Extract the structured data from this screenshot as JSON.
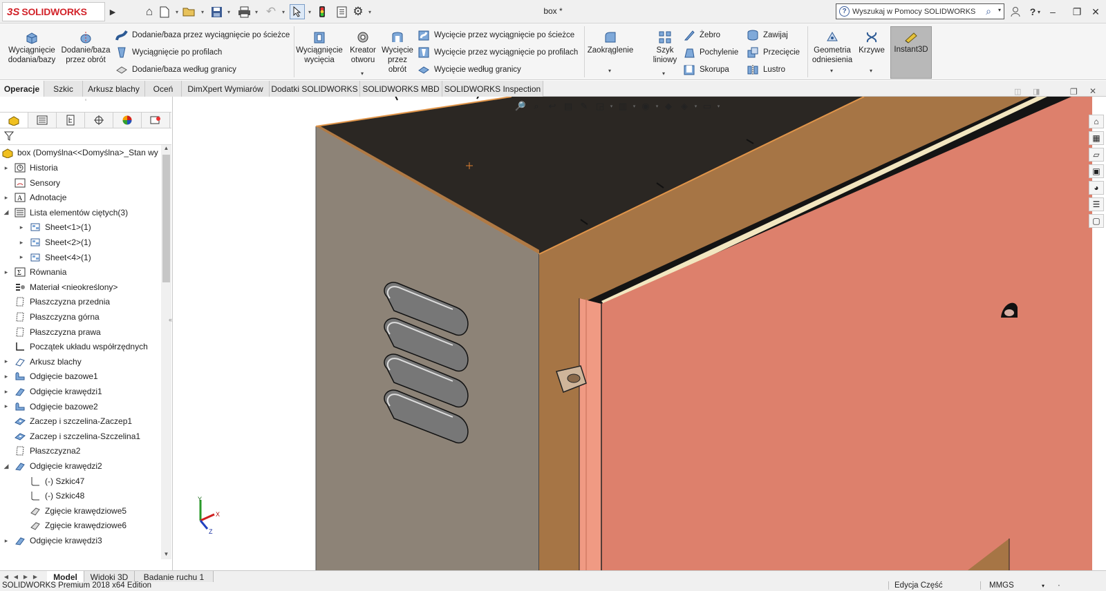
{
  "app": {
    "logo_prefix": "3S",
    "logo_text": "SOLIDWORKS",
    "document_title": "box *",
    "help_search_placeholder": "Wyszukaj w Pomocy SOLIDWORKS"
  },
  "ribbon": {
    "extrude_boss": "Wyciągnięcie dodania/bazy",
    "revolve_boss": "Dodanie/baza przez obrót",
    "swept_boss": "Dodanie/baza przez wyciągnięcie po ścieżce",
    "lofted_boss": "Wyciągnięcie po profilach",
    "boundary_boss": "Dodanie/baza według granicy",
    "extruded_cut": "Wyciągnięcie wycięcia",
    "hole_wizard": "Kreator otworu",
    "revolved_cut": "Wycięcie przez obrót",
    "swept_cut": "Wycięcie przez wyciągnięcie po ścieżce",
    "lofted_cut": "Wycięcie przez wyciągnięcie po profilach",
    "boundary_cut": "Wycięcie według granicy",
    "fillet": "Zaokrąglenie",
    "linear_pattern": "Szyk liniowy",
    "rib": "Żebro",
    "draft": "Pochylenie",
    "shell": "Skorupa",
    "wrap": "Zawijaj",
    "intersect": "Przecięcie",
    "mirror": "Lustro",
    "ref_geometry": "Geometria odniesienia",
    "curves": "Krzywe",
    "instant3d": "Instant3D"
  },
  "command_tabs": [
    "Operacje",
    "Szkic",
    "Arkusz blachy",
    "Oceń",
    "DimXpert Wymiarów",
    "Dodatki SOLIDWORKS",
    "SOLIDWORKS MBD",
    "SOLIDWORKS Inspection"
  ],
  "tree": {
    "root": "box  (Domyślna<<Domyślna>_Stan wy",
    "items": [
      {
        "label": "Historia",
        "icon": "history-icon",
        "expander": true,
        "indent": 0
      },
      {
        "label": "Sensory",
        "icon": "sensor-icon",
        "expander": false,
        "indent": 0
      },
      {
        "label": "Adnotacje",
        "icon": "annotation-icon",
        "expander": true,
        "indent": 0
      },
      {
        "label": "Lista elementów ciętych(3)",
        "icon": "cut-list-icon",
        "expander": "open",
        "indent": 0
      },
      {
        "label": "Sheet<1>(1)",
        "icon": "sheet-body-icon",
        "expander": true,
        "indent": 1
      },
      {
        "label": "Sheet<2>(1)",
        "icon": "sheet-body-icon",
        "expander": true,
        "indent": 1
      },
      {
        "label": "Sheet<4>(1)",
        "icon": "sheet-body-icon",
        "expander": true,
        "indent": 1
      },
      {
        "label": "Równania",
        "icon": "equations-icon",
        "expander": true,
        "indent": 0
      },
      {
        "label": "Materiał <nieokreślony>",
        "icon": "material-icon",
        "expander": false,
        "indent": 0
      },
      {
        "label": "Płaszczyzna przednia",
        "icon": "plane-icon",
        "expander": false,
        "indent": 0
      },
      {
        "label": "Płaszczyzna górna",
        "icon": "plane-icon",
        "expander": false,
        "indent": 0
      },
      {
        "label": "Płaszczyzna prawa",
        "icon": "plane-icon",
        "expander": false,
        "indent": 0
      },
      {
        "label": "Początek układu współrzędnych",
        "icon": "origin-icon",
        "expander": false,
        "indent": 0
      },
      {
        "label": "Arkusz blachy",
        "icon": "sheet-metal-icon",
        "expander": true,
        "indent": 0
      },
      {
        "label": "Odgięcie bazowe1",
        "icon": "base-flange-icon",
        "expander": true,
        "indent": 0
      },
      {
        "label": "Odgięcie krawędzi1",
        "icon": "edge-flange-icon",
        "expander": true,
        "indent": 0
      },
      {
        "label": "Odgięcie bazowe2",
        "icon": "base-flange-icon",
        "expander": true,
        "indent": 0
      },
      {
        "label": "Zaczep i szczelina-Zaczep1",
        "icon": "tab-slot-icon",
        "expander": false,
        "indent": 0
      },
      {
        "label": "Zaczep i szczelina-Szczelina1",
        "icon": "tab-slot-icon",
        "expander": false,
        "indent": 0
      },
      {
        "label": "Płaszczyzna2",
        "icon": "plane-icon",
        "expander": false,
        "indent": 0
      },
      {
        "label": "Odgięcie krawędzi2",
        "icon": "edge-flange-icon",
        "expander": "open",
        "indent": 0
      },
      {
        "label": "(-) Szkic47",
        "icon": "sketch-icon",
        "expander": false,
        "indent": 1
      },
      {
        "label": "(-) Szkic48",
        "icon": "sketch-icon",
        "expander": false,
        "indent": 1
      },
      {
        "label": "Zgięcie krawędziowe5",
        "icon": "edge-bend-icon",
        "expander": false,
        "indent": 1
      },
      {
        "label": "Zgięcie krawędziowe6",
        "icon": "edge-bend-icon",
        "expander": false,
        "indent": 1
      },
      {
        "label": "Odgięcie krawędzi3",
        "icon": "edge-flange-icon",
        "expander": true,
        "indent": 0
      }
    ]
  },
  "bottom_tabs": [
    "Model",
    "Widoki 3D",
    "Badanie ruchu 1"
  ],
  "status": {
    "edition": "SOLIDWORKS Premium 2018 x64 Edition",
    "mode": "Edycja Część",
    "units": "MMGS"
  },
  "triad": {
    "x": "X",
    "y": "Y",
    "z": "Z"
  },
  "colors": {
    "brand_red": "#d2232a",
    "panel_side": "#8c8276",
    "panel_top": "#2a2622",
    "panel_orange": "#a67545",
    "door_salmon": "#dd806c"
  }
}
